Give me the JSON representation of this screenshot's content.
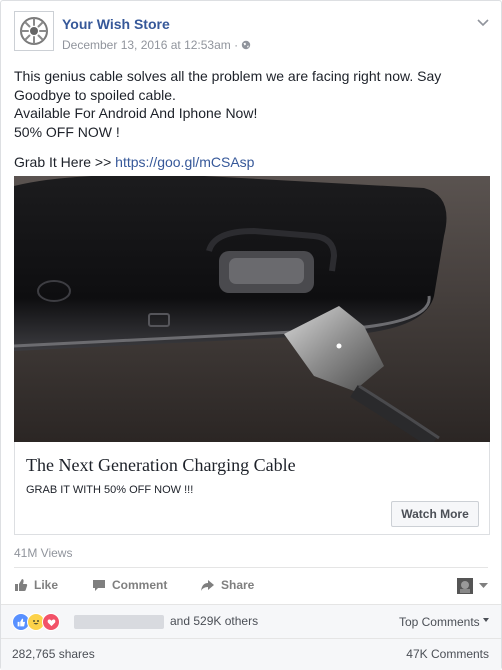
{
  "post": {
    "page_name": "Your Wish Store",
    "timestamp": "December 13, 2016 at 12:53am",
    "separator": "·",
    "text_lines": [
      "This genius cable solves all the problem we are facing right now. Say Goodbye to spoiled cable.",
      "Available For Android And Iphone Now!",
      "50% OFF NOW !"
    ],
    "grab_prefix": "Grab It Here >> ",
    "grab_link": "https://goo.gl/mCSAsp"
  },
  "card": {
    "title": "The Next Generation Charging Cable",
    "subtitle": "GRAB IT WITH 50% OFF NOW !!!",
    "button_label": "Watch More"
  },
  "stats": {
    "views": "41M Views",
    "reactions_others": "and 529K others",
    "top_comments": "Top Comments",
    "shares": "282,765 shares",
    "comments": "47K Comments"
  },
  "actions": {
    "like": "Like",
    "comment": "Comment",
    "share": "Share"
  },
  "colors": {
    "link": "#365899",
    "muted": "#90949c",
    "like_blue": "#5890ff",
    "love_red": "#f25268",
    "haha_yellow": "#fcd24a"
  },
  "icons": [
    "logo-icon",
    "globe-icon",
    "chevron-down-icon",
    "like-icon",
    "comment-icon",
    "share-icon",
    "audience-icon"
  ]
}
